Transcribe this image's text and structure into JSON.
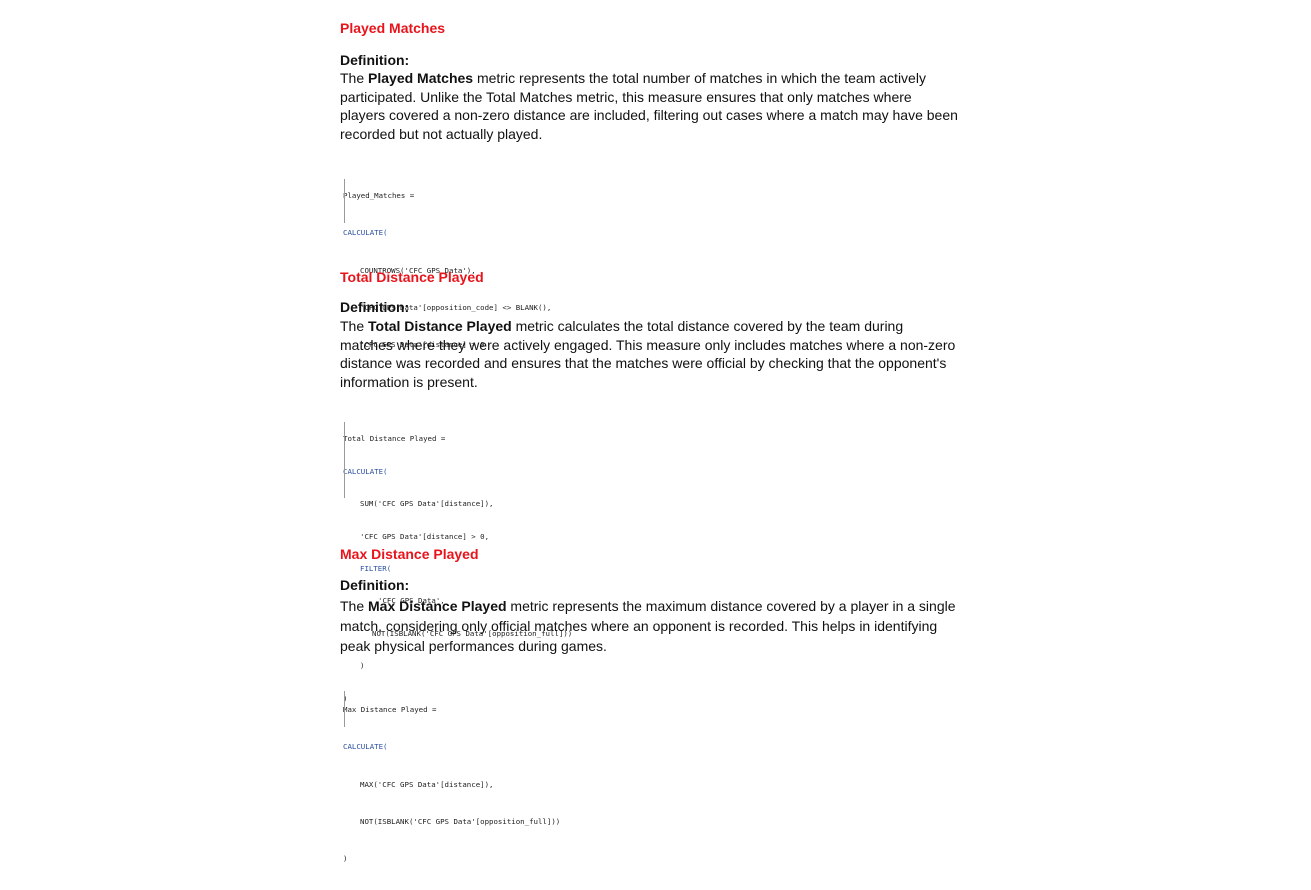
{
  "sections": [
    {
      "title": "Played Matches",
      "definition_label": "Definition:",
      "intro": "The ",
      "metric": "Played Matches",
      "body": " metric represents the total number of matches in which the team actively participated. Unlike the Total Matches metric, this measure ensures that only matches where players covered a non-zero distance are included, filtering out cases where a match may have been recorded but not actually played.",
      "code": [
        "Played_Matches =",
        "CALCULATE(",
        "COUNTROWS('CFC GPS Data'),",
        "'CFC GPS Data'[opposition_code] <> BLANK(),",
        "'CFC GPS Data'[distance] > 0",
        ")"
      ]
    },
    {
      "title": "Total Distance Played",
      "definition_label": "Definition:",
      "intro": "The ",
      "metric": "Total Distance Played",
      "body": " metric calculates the total distance covered by the team during matches where they were actively engaged. This measure only includes matches where a non-zero distance was recorded and ensures that the matches were official by checking that the opponent's information is present.",
      "code": [
        "Total Distance Played =",
        "CALCULATE(",
        "SUM('CFC GPS Data'[distance]),",
        "'CFC GPS Data'[distance] > 0,",
        "FILTER(",
        "'CFC GPS Data',",
        "NOT(ISBLANK('CFC GPS Data'[opposition_full]))",
        ")",
        ")"
      ]
    },
    {
      "title": "Max Distance Played",
      "definition_label": "Definition:",
      "intro": "The ",
      "metric": "Max Distance Played",
      "body": " metric represents the maximum distance covered by a player in a single match, considering only official matches where an opponent is recorded. This helps in identifying peak physical performances during games.",
      "code": [
        "Max Distance Played =",
        "CALCULATE(",
        "MAX('CFC GPS Data'[distance]),",
        "NOT(ISBLANK('CFC GPS Data'[opposition_full]))",
        ")"
      ]
    }
  ]
}
